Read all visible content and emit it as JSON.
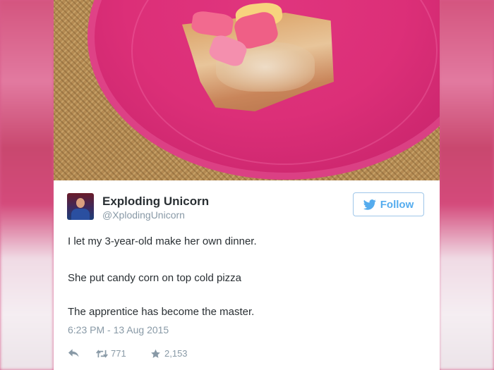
{
  "tweet": {
    "display_name": "Exploding Unicorn",
    "handle": "@XplodingUnicorn",
    "follow_label": "Follow",
    "lines": [
      "I let my 3-year-old make her own dinner.",
      "She put candy corn on top cold pizza",
      "The apprentice has become the master."
    ],
    "timestamp": "6:23 PM - 13 Aug 2015",
    "retweets": "771",
    "favorites": "2,153"
  },
  "icons": {
    "follow": "twitter-bird-icon",
    "reply": "reply-icon",
    "retweet": "retweet-icon",
    "favorite": "star-icon"
  },
  "colors": {
    "twitter_blue": "#55acee",
    "text": "#292f33",
    "muted": "#8899a6",
    "plate_pink": "#dc2f78"
  }
}
